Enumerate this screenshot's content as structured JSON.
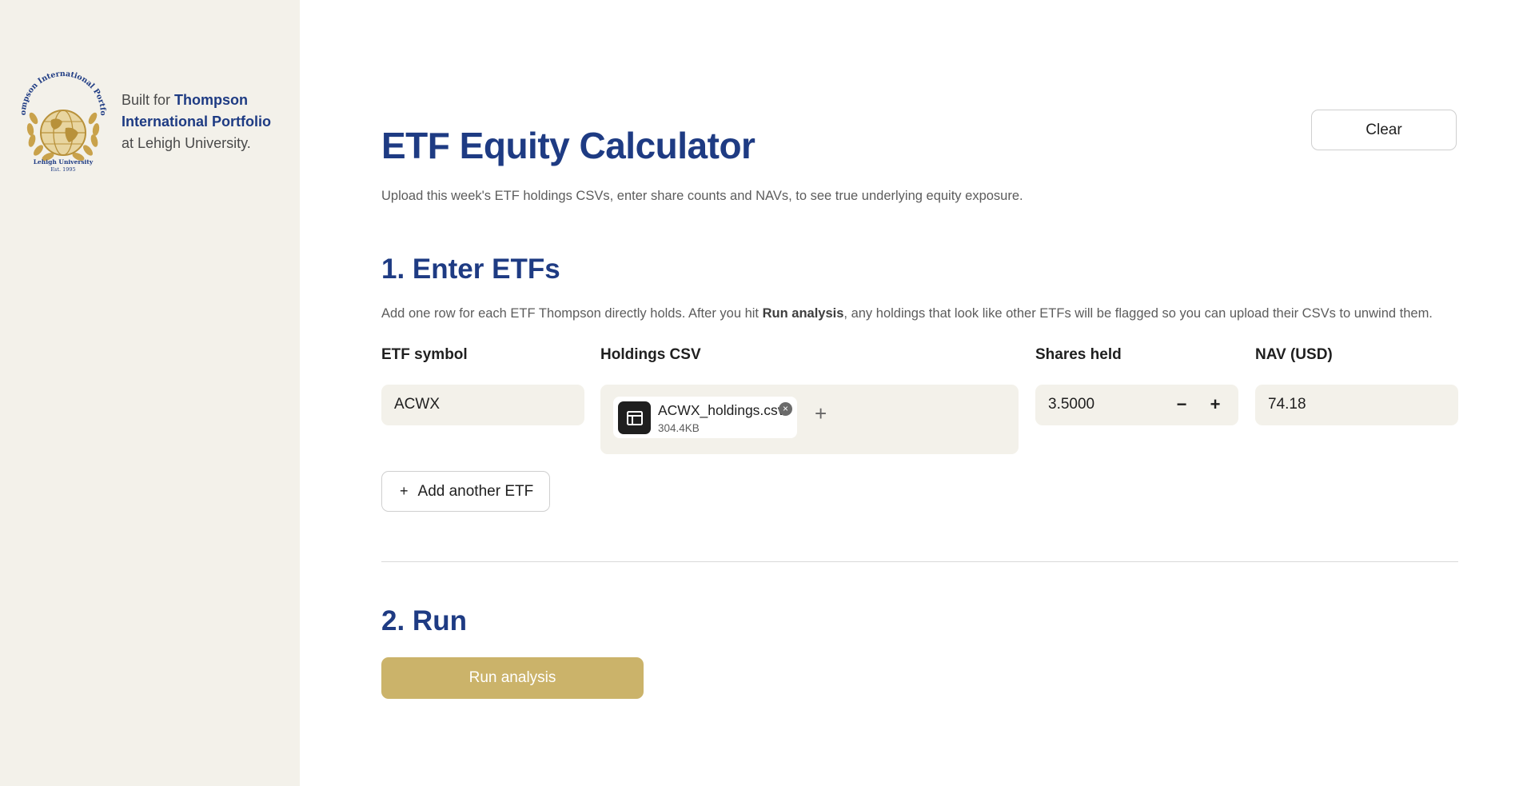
{
  "sidebar": {
    "logo_text": {
      "top_arc": "Thompson International Portfolio",
      "bottom": "Lehigh University",
      "est": "Est. 1995"
    },
    "built_for_prefix": "Built for",
    "built_for_name": "Thompson International Portfolio",
    "built_for_suffix": "at Lehigh University."
  },
  "header": {
    "clear_label": "Clear",
    "title": "ETF Equity Calculator",
    "subtitle": "Upload this week's ETF holdings CSVs, enter share counts and NAVs, to see true underlying equity exposure."
  },
  "section1": {
    "title": "1. Enter ETFs",
    "instructions_before": "Add one row for each ETF Thompson directly holds. After you hit ",
    "instructions_bold": "Run analysis",
    "instructions_after": ", any holdings that look like other ETFs will be flagged so you can upload their CSVs to unwind them.",
    "columns": {
      "symbol": "ETF symbol",
      "csv": "Holdings CSV",
      "shares": "Shares held",
      "nav": "NAV (USD)"
    },
    "row": {
      "symbol": "ACWX",
      "file_name": "ACWX_holdings.csv",
      "file_size": "304.4KB",
      "shares": "3.5000",
      "nav": "74.18"
    },
    "stepper_minus": "−",
    "stepper_plus": "+",
    "file_add": "+",
    "file_remove": "×",
    "add_button_icon": "+",
    "add_button_label": "Add another ETF"
  },
  "section2": {
    "title": "2. Run",
    "run_label": "Run analysis"
  },
  "colors": {
    "accent_blue": "#1e3b83",
    "gold": "#cbb36a",
    "sidebar_bg": "#f3f1ea"
  },
  "icons": {
    "file": "table-icon",
    "remove": "close-circle-icon",
    "logo": "globe-laurel-logo"
  }
}
